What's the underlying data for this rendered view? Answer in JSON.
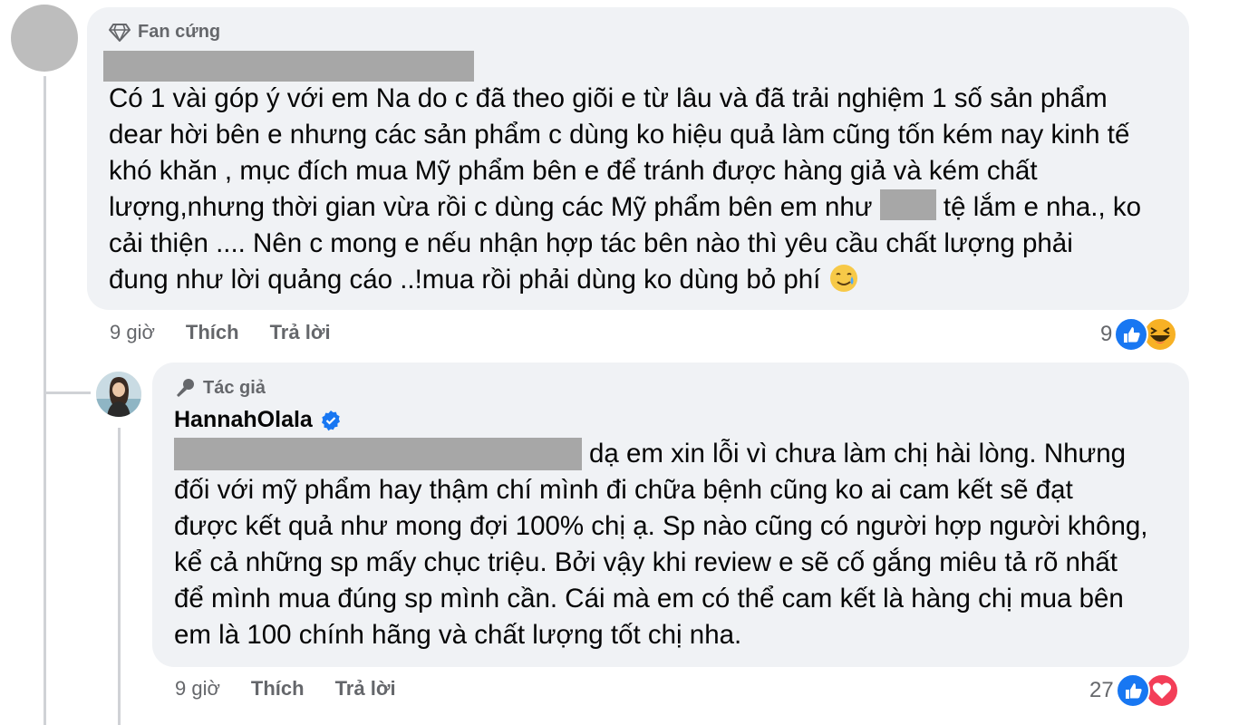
{
  "comment1": {
    "badge": "Fan cứng",
    "lines": [
      "Có 1 vài góp ý với em Na do c đã theo giõi e từ lâu và đã trải nghiệm 1 số sản phẩm",
      "dear hời bên e nhưng các sản phẩm c dùng ko hiệu quả làm cũng tốn kém nay kinh tế",
      "khó khăn , mục đích mua Mỹ phẩm bên e để tránh được hàng giả và kém chất"
    ],
    "line4_a": "lượng,nhưng thời gian vừa rồi c dùng các Mỹ phẩm bên em như ",
    "line4_b": " tệ lắm e nha., ko",
    "lines_after": [
      "cải thiện .... Nên c mong e nếu nhận hợp tác bên nào thì yêu cầu chất lượng phải"
    ],
    "last_line": "đung như lời quảng cáo ..!mua rồi phải dùng ko dùng bỏ phí ",
    "time": "9 giờ",
    "like_label": "Thích",
    "reply_label": "Trả lời",
    "reaction_count": "9",
    "reaction_icons": [
      "like-icon",
      "haha-icon"
    ]
  },
  "comment2": {
    "badge": "Tác giả",
    "author": "HannahOlala",
    "first_line": "dạ em xin lỗi vì chưa làm chị hài lòng. Nhưng",
    "lines": [
      "đối với mỹ phẩm hay thậm chí mình đi chữa bệnh cũng ko ai cam kết sẽ đạt",
      "được kết quả như mong đợi 100% chị ạ. Sp nào cũng có người hợp người không,",
      "kể cả những sp mấy chục triệu. Bởi vậy khi review e sẽ cố gắng miêu tả rõ nhất",
      "để mình mua đúng sp mình cần. Cái mà em có thể cam kết là hàng chị mua bên",
      "em là 100 chính hãng và chất lượng tốt chị nha."
    ],
    "time": "9 giờ",
    "like_label": "Thích",
    "reply_label": "Trả lời",
    "reaction_count": "27",
    "reaction_icons": [
      "like-icon",
      "love-icon"
    ]
  },
  "colors": {
    "bubble": "#f0f2f5",
    "like_blue": "#1877f2",
    "love_red": "#f33e58",
    "haha_yellow": "#f7b125",
    "muted": "#65676b"
  }
}
